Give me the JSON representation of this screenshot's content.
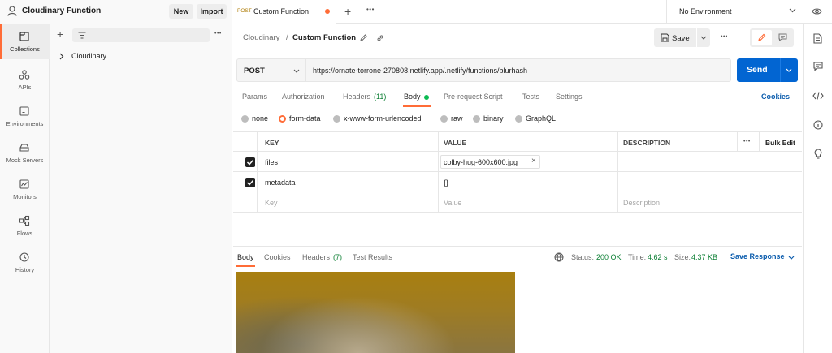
{
  "workspace": {
    "name": "Cloudinary Function",
    "new_label": "New",
    "import_label": "Import"
  },
  "tabs": {
    "active": {
      "method": "POST",
      "title": "Custom Function"
    },
    "environment": "No Environment"
  },
  "leftnav": {
    "items": [
      {
        "label": "Collections",
        "icon": "collections-icon"
      },
      {
        "label": "APIs",
        "icon": "apis-icon"
      },
      {
        "label": "Environments",
        "icon": "environments-icon"
      },
      {
        "label": "Mock Servers",
        "icon": "mock-servers-icon"
      },
      {
        "label": "Monitors",
        "icon": "monitors-icon"
      },
      {
        "label": "Flows",
        "icon": "flows-icon"
      },
      {
        "label": "History",
        "icon": "history-icon"
      }
    ]
  },
  "sidebar": {
    "collections": [
      "Cloudinary"
    ]
  },
  "request": {
    "breadcrumb_parent": "Cloudinary",
    "breadcrumb_sep": "/",
    "name": "Custom Function",
    "save_label": "Save",
    "method": "POST",
    "url": "https://ornate-torrone-270808.netlify.app/.netlify/functions/blurhash",
    "send_label": "Send"
  },
  "request_tabs": {
    "params": "Params",
    "authorization": "Authorization",
    "headers": "Headers",
    "headers_count": "(11)",
    "body": "Body",
    "prerequest": "Pre-request Script",
    "tests": "Tests",
    "settings": "Settings",
    "cookies": "Cookies"
  },
  "body_types": {
    "none": "none",
    "form_data": "form-data",
    "urlencoded": "x-www-form-urlencoded",
    "raw": "raw",
    "binary": "binary",
    "graphql": "GraphQL"
  },
  "table": {
    "headers": {
      "key": "KEY",
      "value": "VALUE",
      "description": "DESCRIPTION",
      "more": "•••",
      "bulk_edit": "Bulk Edit"
    },
    "rows": [
      {
        "key": "files",
        "value": "colby-hug-600x600.jpg",
        "remove": "×"
      },
      {
        "key": "metadata",
        "value": "{}"
      }
    ],
    "placeholder": {
      "key": "Key",
      "value": "Value",
      "description": "Description"
    }
  },
  "response": {
    "tabs": {
      "body": "Body",
      "cookies": "Cookies",
      "headers": "Headers",
      "headers_count": "(7)",
      "test_results": "Test Results"
    },
    "status_label": "Status:",
    "status_value": "200 OK",
    "time_label": "Time:",
    "time_value": "4.62 s",
    "size_label": "Size:",
    "size_value": "4.37 KB",
    "save_response": "Save Response"
  },
  "colors": {
    "accent": "#ff6c37",
    "send_blue": "#0265d2",
    "link_blue": "#0b5cad",
    "status_green": "#0a7e32"
  }
}
